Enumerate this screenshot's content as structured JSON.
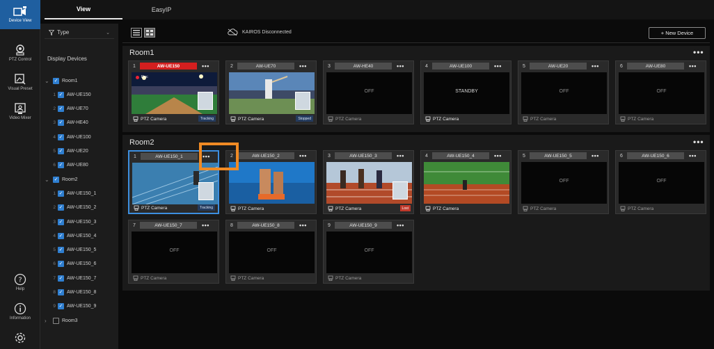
{
  "tabs": [
    {
      "label": "View",
      "active": true
    },
    {
      "label": "EasyIP",
      "active": false
    }
  ],
  "rail": [
    {
      "icon": "device-view-icon",
      "label": "Device View",
      "active": true
    },
    {
      "icon": "ptz-control-icon",
      "label": "PTZ Control",
      "active": false
    },
    {
      "icon": "visual-preset-icon",
      "label": "Visual Preset",
      "active": false
    },
    {
      "icon": "video-mixer-icon",
      "label": "Video Mixer",
      "active": false
    },
    {
      "icon": "help-icon",
      "label": "Help",
      "active": false
    },
    {
      "icon": "information-icon",
      "label": "Information",
      "active": false
    },
    {
      "icon": "settings-icon",
      "label": "",
      "active": false
    }
  ],
  "sidebar": {
    "type_filter": "Type",
    "title": "Display Devices",
    "groups": [
      {
        "name": "Room1",
        "expanded": true,
        "checked": true,
        "devices": [
          {
            "num": "1",
            "name": "AW-UE150"
          },
          {
            "num": "2",
            "name": "AW-UE70"
          },
          {
            "num": "3",
            "name": "AW-HE40"
          },
          {
            "num": "4",
            "name": "AW-UE100"
          },
          {
            "num": "5",
            "name": "AW-UE20"
          },
          {
            "num": "6",
            "name": "AW-UE80"
          }
        ]
      },
      {
        "name": "Room2",
        "expanded": true,
        "checked": true,
        "devices": [
          {
            "num": "1",
            "name": "AW-UE150_1"
          },
          {
            "num": "2",
            "name": "AW-UE150_2"
          },
          {
            "num": "3",
            "name": "AW-UE150_3"
          },
          {
            "num": "4",
            "name": "AW-UE150_4"
          },
          {
            "num": "5",
            "name": "AW-UE150_5"
          },
          {
            "num": "6",
            "name": "AW-UE150_6"
          },
          {
            "num": "7",
            "name": "AW-UE150_7"
          },
          {
            "num": "8",
            "name": "AW-UE150_8"
          },
          {
            "num": "9",
            "name": "AW-UE150_9"
          }
        ]
      },
      {
        "name": "Room3",
        "expanded": false,
        "checked": false,
        "devices": []
      }
    ]
  },
  "toolbar": {
    "kairos_status": "KAIROS Disconnected",
    "new_device_label": "+ New Device"
  },
  "rooms": [
    {
      "title": "Room1",
      "menu": "•••",
      "cards": [
        {
          "num": "1",
          "name": "AW-UE150",
          "onair": true,
          "screen": "stadium",
          "status": "",
          "footer": "PTZ Camera",
          "badge": "Tracking",
          "rec": "Rec"
        },
        {
          "num": "2",
          "name": "AW-UE70",
          "onair": false,
          "screen": "baseball",
          "status": "",
          "footer": "PTZ Camera",
          "badge": "Stopped",
          "rec": ""
        },
        {
          "num": "3",
          "name": "AW-HE40",
          "onair": false,
          "screen": "off",
          "status": "OFF",
          "footer": "PTZ Camera",
          "badge": "",
          "rec": ""
        },
        {
          "num": "4",
          "name": "AW-UE100",
          "onair": false,
          "screen": "standby",
          "status": "STANDBY",
          "footer": "PTZ Camera",
          "badge": "",
          "rec": ""
        },
        {
          "num": "5",
          "name": "AW-UE20",
          "onair": false,
          "screen": "off",
          "status": "OFF",
          "footer": "PTZ Camera",
          "badge": "",
          "rec": ""
        },
        {
          "num": "6",
          "name": "AW-UE80",
          "onair": false,
          "screen": "off",
          "status": "OFF",
          "footer": "PTZ Camera",
          "badge": "",
          "rec": ""
        }
      ]
    },
    {
      "title": "Room2",
      "menu": "•••",
      "cards": [
        {
          "num": "1",
          "name": "AW-UE150_1",
          "onair": false,
          "screen": "track",
          "status": "",
          "footer": "PTZ Camera",
          "badge": "Tracking",
          "rec": "",
          "selected": true
        },
        {
          "num": "2",
          "name": "AW-UE150_2",
          "onair": false,
          "screen": "runner",
          "status": "",
          "footer": "PTZ Camera",
          "badge": "",
          "rec": ""
        },
        {
          "num": "3",
          "name": "AW-UE150_3",
          "onair": false,
          "screen": "sprint",
          "status": "",
          "footer": "PTZ Camera",
          "badge": "Lost",
          "rec": ""
        },
        {
          "num": "4",
          "name": "AW-UE150_4",
          "onair": false,
          "screen": "field",
          "status": "",
          "footer": "PTZ Camera",
          "badge": "",
          "rec": ""
        },
        {
          "num": "5",
          "name": "AW-UE150_5",
          "onair": false,
          "screen": "off",
          "status": "OFF",
          "footer": "PTZ Camera",
          "badge": "",
          "rec": ""
        },
        {
          "num": "6",
          "name": "AW-UE150_6",
          "onair": false,
          "screen": "off",
          "status": "OFF",
          "footer": "PTZ Camera",
          "badge": "",
          "rec": ""
        },
        {
          "num": "7",
          "name": "AW-UE150_7",
          "onair": false,
          "screen": "off",
          "status": "OFF",
          "footer": "PTZ Camera",
          "badge": "",
          "rec": ""
        },
        {
          "num": "8",
          "name": "AW-UE150_8",
          "onair": false,
          "screen": "off",
          "status": "OFF",
          "footer": "PTZ Camera",
          "badge": "",
          "rec": ""
        },
        {
          "num": "9",
          "name": "AW-UE150_9",
          "onair": false,
          "screen": "off",
          "status": "OFF",
          "footer": "PTZ Camera",
          "badge": "",
          "rec": ""
        }
      ]
    }
  ],
  "card_menu": "•••",
  "colors": {
    "accent": "#2f7fd1",
    "onair": "#d41f1f",
    "highlight": "#f08a24",
    "selected_border": "#3d8fe0"
  }
}
